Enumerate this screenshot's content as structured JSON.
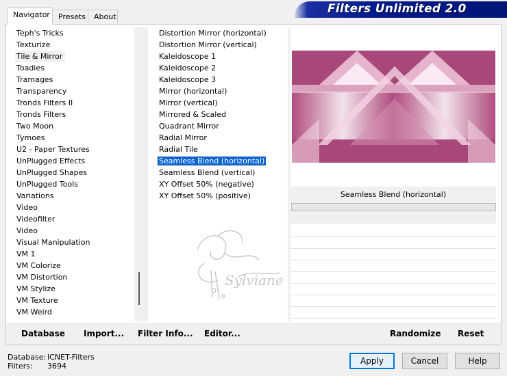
{
  "tabs": [
    {
      "label": "Navigator",
      "active": true
    },
    {
      "label": "Presets",
      "active": false
    },
    {
      "label": "About",
      "active": false
    }
  ],
  "banner": {
    "title": "Filters Unlimited 2.0"
  },
  "categories": {
    "current": "Tile & Mirror",
    "items": [
      "Teph's Tricks",
      "Texturize",
      "Tile & Mirror",
      "Toadies",
      "Tramages",
      "Transparency",
      "Tronds Filters II",
      "Tronds Filters",
      "Two Moon",
      "Tymoes",
      "U2 - Paper Textures",
      "UnPlugged Effects",
      "UnPlugged Shapes",
      "UnPlugged Tools",
      "Variations",
      "Video",
      "Videofilter",
      "Video",
      "Visual Manipulation",
      "VM 1",
      "VM Colorize",
      "VM Distortion",
      "VM Stylize",
      "VM Texture",
      "VM Weird"
    ]
  },
  "filters": {
    "selected": "Seamless Blend (horizontal)",
    "items": [
      "Distortion Mirror (horizontal)",
      "Distortion Mirror (vertical)",
      "Kaleidoscope 1",
      "Kaleidoscope 2",
      "Kaleidoscope 3",
      "Mirror (horizontal)",
      "Mirror (vertical)",
      "Mirrored & Scaled",
      "Quadrant Mirror",
      "Radial Mirror",
      "Radial Tile",
      "Seamless Blend (horizontal)",
      "Seamless Blend (vertical)",
      "XY Offset 50% (negative)",
      "XY Offset 50% (positive)"
    ]
  },
  "preview": {
    "filter_name": "Seamless Blend (horizontal)",
    "accent": "#b14d80"
  },
  "toolbar": {
    "database": "Database",
    "import": "Import...",
    "filter_info": "Filter Info...",
    "editor": "Editor...",
    "randomize": "Randomize",
    "reset": "Reset"
  },
  "footer": {
    "database_label": "Database:",
    "database_value": "ICNET-Filters",
    "filters_label": "Filters:",
    "filters_value": "3694",
    "apply": "Apply",
    "cancel": "Cancel",
    "help": "Help"
  },
  "watermark": {
    "text": "Sylviane"
  }
}
